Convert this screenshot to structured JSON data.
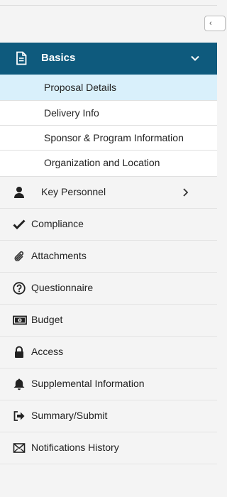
{
  "sidebar": {
    "section": {
      "label": "Basics",
      "icon": "document-icon"
    },
    "subitems": [
      {
        "label": "Proposal Details",
        "active": true
      },
      {
        "label": "Delivery Info"
      },
      {
        "label": "Sponsor & Program Information"
      },
      {
        "label": "Organization and Location"
      }
    ],
    "items": [
      {
        "label": "Key Personnel",
        "icon": "person-icon",
        "has_children": true
      },
      {
        "label": "Compliance",
        "icon": "checkmark-icon"
      },
      {
        "label": "Attachments",
        "icon": "paperclip-icon"
      },
      {
        "label": "Questionnaire",
        "icon": "question-circle-icon"
      },
      {
        "label": "Budget",
        "icon": "money-icon"
      },
      {
        "label": "Access",
        "icon": "lock-icon"
      },
      {
        "label": "Supplemental Information",
        "icon": "bell-icon"
      },
      {
        "label": "Summary/Submit",
        "icon": "sign-out-icon"
      },
      {
        "label": "Notifications History",
        "icon": "envelope-icon"
      }
    ]
  },
  "colors": {
    "section_bg": "#0e5a7d",
    "active_bg": "#d9f0fb"
  }
}
